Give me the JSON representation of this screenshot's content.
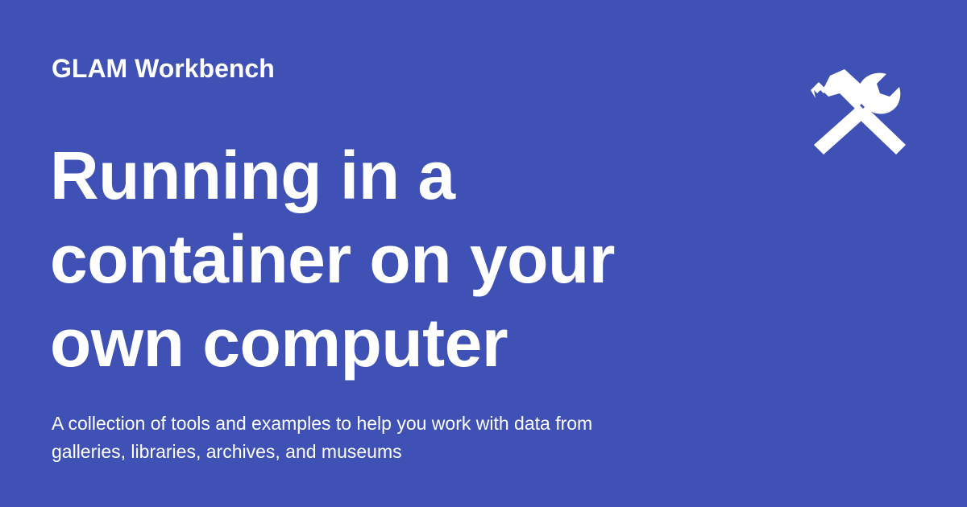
{
  "card": {
    "background_color": "#3f51b5",
    "text_color": "#ffffff",
    "site_name": "GLAM Workbench",
    "title_lines": [
      "Running in a",
      "container on your",
      "own computer"
    ],
    "description_lines": [
      "A collection of tools and examples to help you work with data from",
      "galleries, libraries, archives, and museums"
    ],
    "logo_icon": "tools-icon"
  }
}
